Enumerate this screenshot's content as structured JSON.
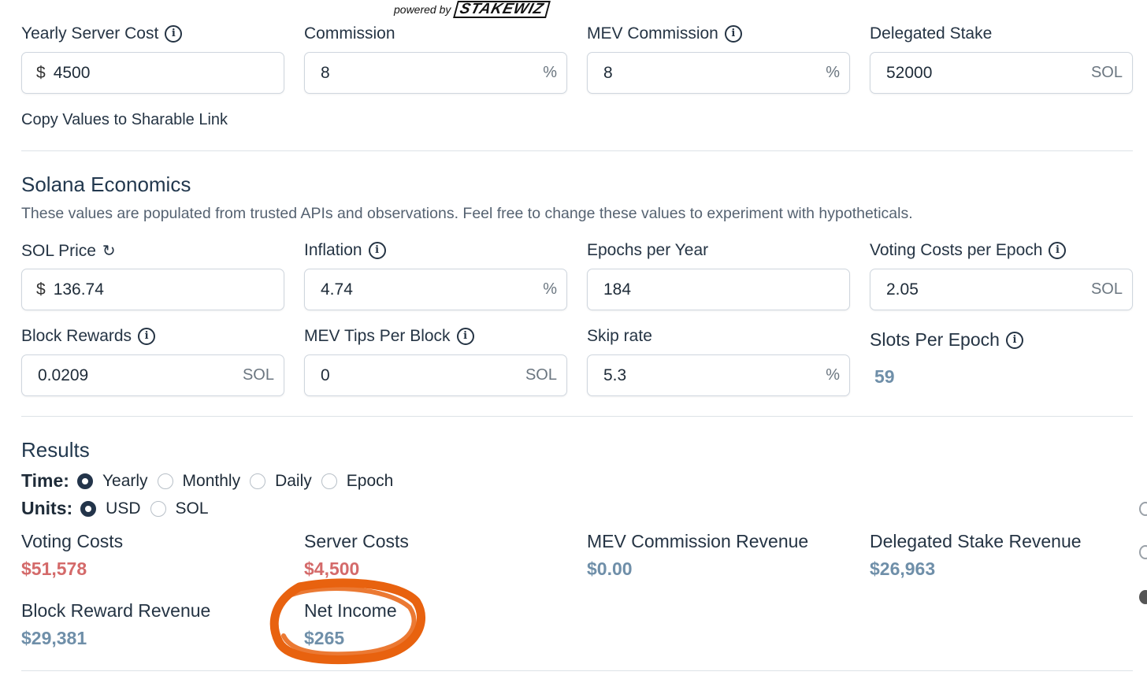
{
  "header": {
    "powered_by": "powered by",
    "brand": "STAKEWIZ"
  },
  "validator": {
    "yearly_server_cost": {
      "label": "Yearly Server Cost",
      "prefix": "$",
      "value": "4500"
    },
    "commission": {
      "label": "Commission",
      "value": "8",
      "suffix": "%"
    },
    "mev_commission": {
      "label": "MEV Commission",
      "value": "8",
      "suffix": "%"
    },
    "delegated_stake": {
      "label": "Delegated Stake",
      "value": "52000",
      "suffix": "SOL"
    },
    "copy_link": "Copy Values to Sharable Link"
  },
  "economics": {
    "title": "Solana Economics",
    "description": "These values are populated from trusted APIs and observations. Feel free to change these values to experiment with hypotheticals.",
    "sol_price": {
      "label": "SOL Price",
      "prefix": "$",
      "value": "136.74"
    },
    "inflation": {
      "label": "Inflation",
      "value": "4.74",
      "suffix": "%"
    },
    "epochs_per_year": {
      "label": "Epochs per Year",
      "value": "184"
    },
    "voting_costs": {
      "label": "Voting Costs per Epoch",
      "value": "2.05",
      "suffix": "SOL"
    },
    "block_rewards": {
      "label": "Block Rewards",
      "value": "0.0209",
      "suffix": "SOL"
    },
    "mev_tips": {
      "label": "MEV Tips Per Block",
      "value": "0",
      "suffix": "SOL"
    },
    "skip_rate": {
      "label": "Skip rate",
      "value": "5.3",
      "suffix": "%"
    },
    "slots_per_epoch": {
      "label": "Slots Per Epoch",
      "value": "59"
    }
  },
  "results": {
    "title": "Results",
    "time": {
      "label": "Time:",
      "options": [
        "Yearly",
        "Monthly",
        "Daily",
        "Epoch"
      ],
      "selected": "Yearly"
    },
    "units": {
      "label": "Units:",
      "options": [
        "USD",
        "SOL"
      ],
      "selected": "USD"
    },
    "voting_costs": {
      "label": "Voting Costs",
      "value": "$51,578"
    },
    "server_costs": {
      "label": "Server Costs",
      "value": "$4,500"
    },
    "mev_revenue": {
      "label": "MEV Commission Revenue",
      "value": "$0.00"
    },
    "delegated_revenue": {
      "label": "Delegated Stake Revenue",
      "value": "$26,963"
    },
    "block_reward_revenue": {
      "label": "Block Reward Revenue",
      "value": "$29,381"
    },
    "net_income": {
      "label": "Net Income",
      "value": "$265"
    }
  },
  "colors": {
    "cost": "#d46a6a",
    "revenue": "#6f8fa9",
    "annotation": "#e8620f",
    "text": "#253444"
  }
}
